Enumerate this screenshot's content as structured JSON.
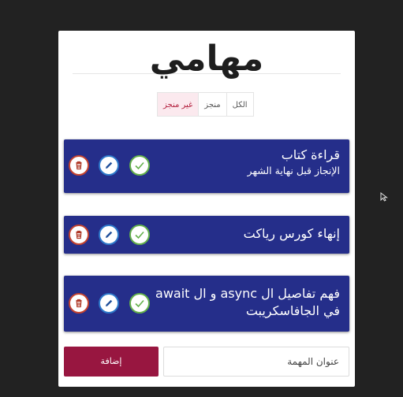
{
  "title": "مهامي",
  "filters": [
    {
      "label": "الكل",
      "active": false
    },
    {
      "label": "منجز",
      "active": false
    },
    {
      "label": "غير منجز",
      "active": true
    }
  ],
  "tasks": [
    {
      "title": "قراءة كتاب",
      "description": "الإنجاز قبل نهاية الشهر"
    },
    {
      "title": "إنهاء كورس رياكت",
      "description": ""
    },
    {
      "title": "فهم تفاصيل ال async و ال await في الجافاسكريبت",
      "description": ""
    }
  ],
  "form": {
    "add_label": "إضافة",
    "placeholder": "عنوان المهمة",
    "value": ""
  },
  "icons": {
    "delete": "trash-icon",
    "edit": "pencil-icon",
    "done": "check-icon"
  },
  "colors": {
    "background": "#222222",
    "task_bg": "#252e8a",
    "add_button": "#981640",
    "active_filter_text": "#b21d3b",
    "delete": "#c4432f",
    "edit": "#2d78c9",
    "done": "#63b04a"
  }
}
